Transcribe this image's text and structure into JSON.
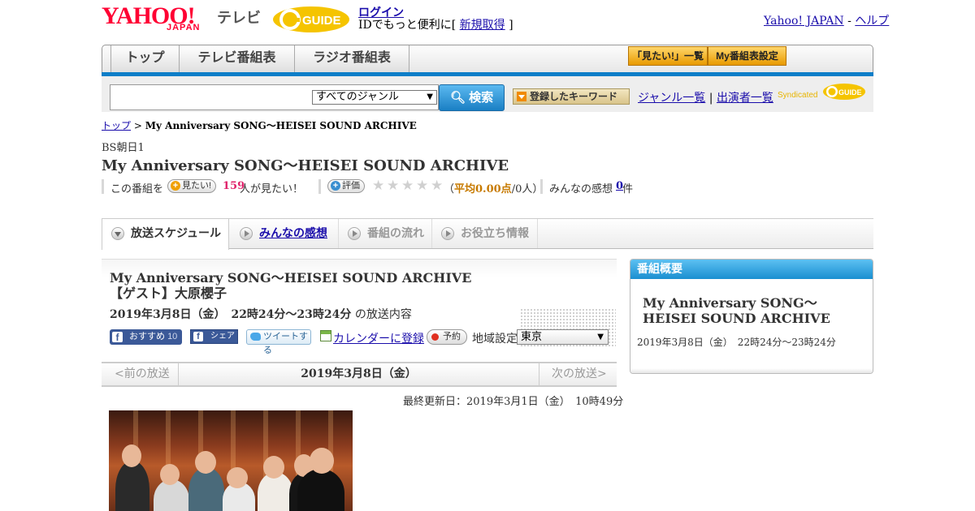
{
  "header": {
    "logo_yahoo": "YAHOO!",
    "logo_japan": "JAPAN",
    "logo_tv": "テレビ",
    "login_link": "ログイン",
    "login_prefix": "IDでもっと便利に[ ",
    "signup_link": "新規取得",
    "login_suffix": " ]",
    "yahoo_japan_link": "Yahoo! JAPAN",
    "header_sep": " - ",
    "help_link": "ヘルプ"
  },
  "nav": {
    "tabs": [
      {
        "label": "トップ"
      },
      {
        "label": "テレビ番組表"
      },
      {
        "label": "ラジオ番組表"
      }
    ],
    "want_list_button": "「見たい!」一覧",
    "my_schedule_button": "My番組表設定"
  },
  "search": {
    "input_value": "",
    "genre_selected": "すべてのジャンル",
    "search_button": "検索",
    "keyword_button": "登録したキーワード",
    "genre_list_link": "ジャンル一覧",
    "link_sep": " | ",
    "performers_link": "出演者一覧",
    "syndicated": "Syndicated"
  },
  "breadcrumb": {
    "top_link": "トップ",
    "sep": " > ",
    "current": "My Anniversary SONG～HEISEI SOUND ARCHIVE"
  },
  "program": {
    "channel": "BS朝日1",
    "title": "My Anniversary SONG～HEISEI SOUND ARCHIVE",
    "want_prefix": "この番組を",
    "want_button": "見たい!",
    "want_count": "159",
    "want_suffix": "人が見たい！",
    "rate_button": "評価",
    "stars": [
      "★",
      "★",
      "★",
      "★",
      "★"
    ],
    "rating_open": "（",
    "rating_avg": "平均0.00点",
    "rating_people": "/0人）",
    "impressions_label": "みんなの感想",
    "impressions_count": "0",
    "impressions_suffix": "件"
  },
  "program_tabs": [
    {
      "label": "放送スケジュール",
      "active": true
    },
    {
      "label": "みんなの感想",
      "link": true
    },
    {
      "label": "番組の流れ"
    },
    {
      "label": "お役立ち情報"
    }
  ],
  "detail": {
    "title": "My Anniversary SONG～HEISEI SOUND ARCHIVE　【ゲスト】大原櫻子",
    "date_bold": "2019年3月8日（金）　22時24分～23時24分",
    "date_suffix": " の放送内容",
    "fb_recommend": "おすすめ",
    "fb_recommend_count": "10",
    "fb_share": "シェア",
    "tweet": "ツイートする",
    "calendar_link": "カレンダーに登録",
    "reserve_button": "予約",
    "region_label": "地域設定",
    "region_selected": "東京",
    "prev_broadcast": "<前の放送",
    "current_date": "2019年3月8日（金）",
    "next_broadcast": "次の放送>",
    "last_updated": "最終更新日：2019年3月1日（金）　10時49分"
  },
  "sidebar": {
    "heading": "番組概要",
    "title": "My Anniversary SONG～HEISEI SOUND ARCHIVE",
    "datetime": "2019年3月8日（金）　22時24分～23時24分"
  },
  "colors": {
    "yahoo_red": "#ff0033",
    "nav_blue": "#0d7ec8",
    "link": "#1a0dab",
    "want_count_pink": "#e0246b",
    "rating_orange": "#c77a00",
    "sidebar_head": "#1a8fd0"
  }
}
